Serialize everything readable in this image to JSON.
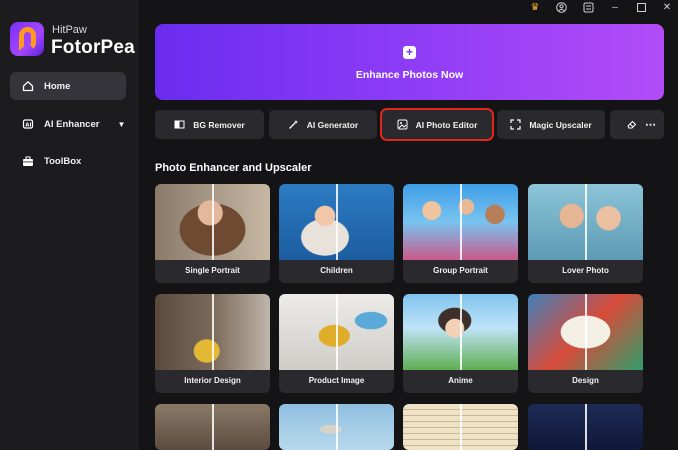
{
  "app": {
    "brand_sub": "HitPaw",
    "brand_title": "FotorPea"
  },
  "sidebar": {
    "items": [
      {
        "label": "Home",
        "icon": "home-icon"
      },
      {
        "label": "AI Enhancer",
        "icon": "sparkle-icon"
      },
      {
        "label": "ToolBox",
        "icon": "toolbox-icon"
      }
    ]
  },
  "titlebar": {
    "icons": [
      "crown-icon",
      "user-icon",
      "settings-icon",
      "minimize-icon",
      "maximize-icon",
      "close-icon"
    ]
  },
  "banner": {
    "label": "Enhance Photos Now"
  },
  "tools": [
    {
      "label": "BG Remover"
    },
    {
      "label": "AI Generator"
    },
    {
      "label": "AI Photo Editor"
    },
    {
      "label": "Magic Upscaler"
    }
  ],
  "section": {
    "title": "Photo Enhancer and Upscaler"
  },
  "cards": [
    {
      "label": "Single Portrait"
    },
    {
      "label": "Children"
    },
    {
      "label": "Group Portrait"
    },
    {
      "label": "Lover Photo"
    },
    {
      "label": "Interior Design"
    },
    {
      "label": "Product Image"
    },
    {
      "label": "Anime"
    },
    {
      "label": "Design"
    }
  ],
  "colors": {
    "accent_red": "#e1261c",
    "banner_start": "#6a2cf0",
    "banner_end": "#b24cf8",
    "sidebar_bg": "#1c1c1f",
    "main_bg": "#141416"
  }
}
